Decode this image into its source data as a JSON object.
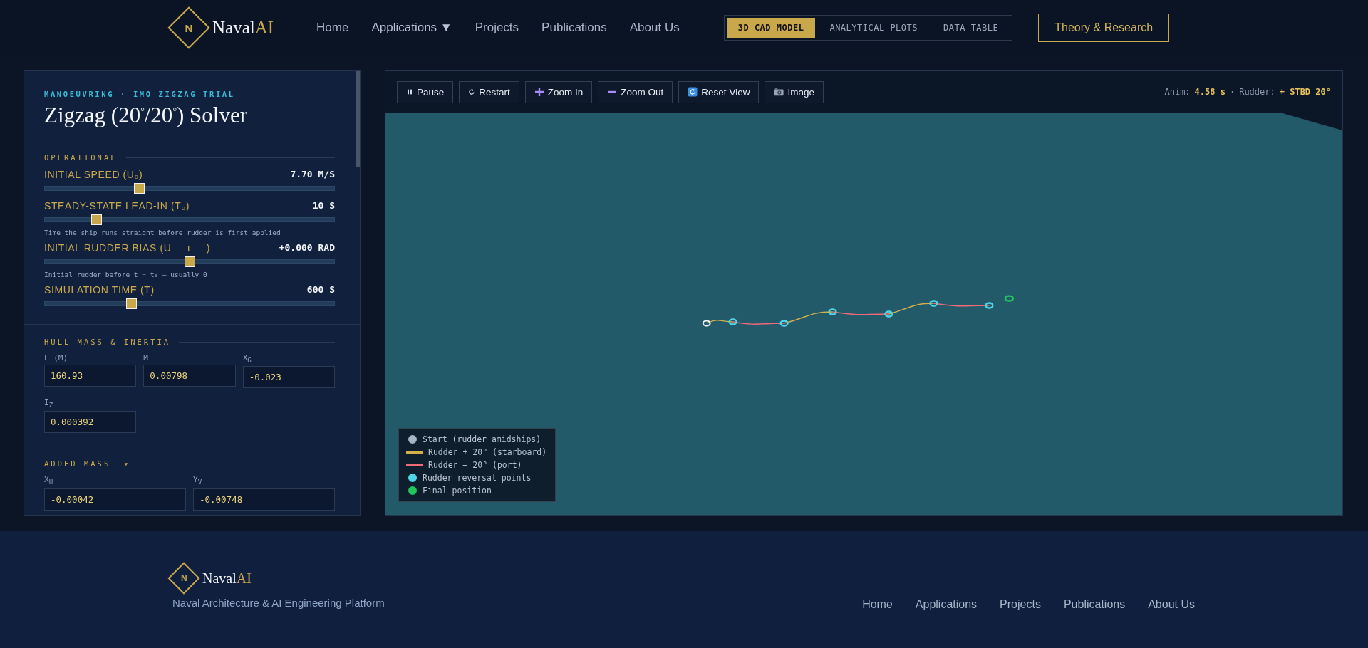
{
  "header": {
    "brand": {
      "mark": "N",
      "main": "Naval",
      "accent": "AI"
    },
    "nav": [
      {
        "label": "Home",
        "selected": false
      },
      {
        "label": "Applications",
        "selected": true,
        "caret": "▼"
      },
      {
        "label": "Projects",
        "selected": false
      },
      {
        "label": "Publications",
        "selected": false
      },
      {
        "label": "About Us",
        "selected": false
      }
    ],
    "views": [
      {
        "label": "3D CAD MODEL",
        "selected": true
      },
      {
        "label": "ANALYTICAL PLOTS",
        "selected": false
      },
      {
        "label": "DATA TABLE",
        "selected": false
      }
    ],
    "cta": "Theory & Research"
  },
  "panel": {
    "eyebrow": "MANOEUVRING · IMO ZIGZAG TRIAL",
    "title": "Zigzag (20$^{°}$/20$^{°}$) Solver",
    "sections": [
      {
        "title": "OPERATIONAL",
        "kind": "sliders",
        "sliders": [
          {
            "label": "INITIAL SPEED (U₀)",
            "reading": "7.70 M/S",
            "level": 0.325
          },
          {
            "label": "STEADY-STATE LEAD-IN (T₀)",
            "reading": "10 S",
            "level": 0.18,
            "hint": "Time the ship runs straight before rudder is first applied"
          },
          {
            "label": "INITIAL RUDDER BIAS (U     ı     )",
            "reading": "+0.000 RAD",
            "level": 0.5,
            "hint": "Initial rudder before t = t₀ — usually 0"
          },
          {
            "label": "SIMULATION TIME (T)",
            "reading": "600 S",
            "level": 0.3
          }
        ]
      },
      {
        "title": "HULL MASS & INERTIA",
        "kind": "fields3",
        "fields": [
          {
            "label": "L (M)",
            "value": "160.93"
          },
          {
            "label": "M",
            "value": "0.00798"
          },
          {
            "label": "X$_{G}$",
            "value": "-0.023"
          },
          {
            "label": "I$_{Z}$",
            "value": "0.000392"
          }
        ]
      },
      {
        "title": "ADDED MASS",
        "caret": "▾",
        "kind": "fields2",
        "fields": [
          {
            "label": "X$_{U̇}$",
            "value": "-0.00042"
          },
          {
            "label": "Y$_{V̇}$",
            "value": "-0.00748"
          }
        ]
      }
    ]
  },
  "viewer": {
    "buttons": [
      {
        "label": "Pause",
        "kind": "pause"
      },
      {
        "label": "Restart",
        "kind": "restart"
      },
      {
        "label": "Zoom In",
        "kind": "zoom_in"
      },
      {
        "label": "Zoom Out",
        "kind": "zoom_out"
      },
      {
        "label": "Reset View",
        "kind": "reset"
      },
      {
        "label": "Image",
        "kind": "image"
      }
    ],
    "status": [
      {
        "text": "Anim:",
        "kind": "label"
      },
      {
        "text": "4.58 s",
        "kind": "value"
      },
      {
        "text": "·",
        "kind": "label"
      },
      {
        "text": "Rudder:",
        "kind": "label"
      },
      {
        "text": "+ STBD 20°",
        "kind": "value"
      }
    ],
    "legend": [
      {
        "label": "Start (rudder amidships)",
        "kind": "dot",
        "color": "#a9b4c8"
      },
      {
        "label": "Rudder + 20° (starboard)",
        "kind": "line",
        "color": "#d4af4a"
      },
      {
        "label": "Rudder − 20° (port)",
        "kind": "line",
        "color": "#f06a7a"
      },
      {
        "label": "Rudder reversal points",
        "kind": "dot",
        "color": "#4fd6e6"
      },
      {
        "label": "Final position",
        "kind": "dot",
        "color": "#22c55e"
      }
    ]
  },
  "footer": {
    "brand": {
      "mark": "N",
      "main": "Naval",
      "accent": "AI"
    },
    "tagline": "Naval Architecture & AI Engineering Platform",
    "links": [
      "Home",
      "Applications",
      "Projects",
      "Publications",
      "About Us"
    ]
  }
}
